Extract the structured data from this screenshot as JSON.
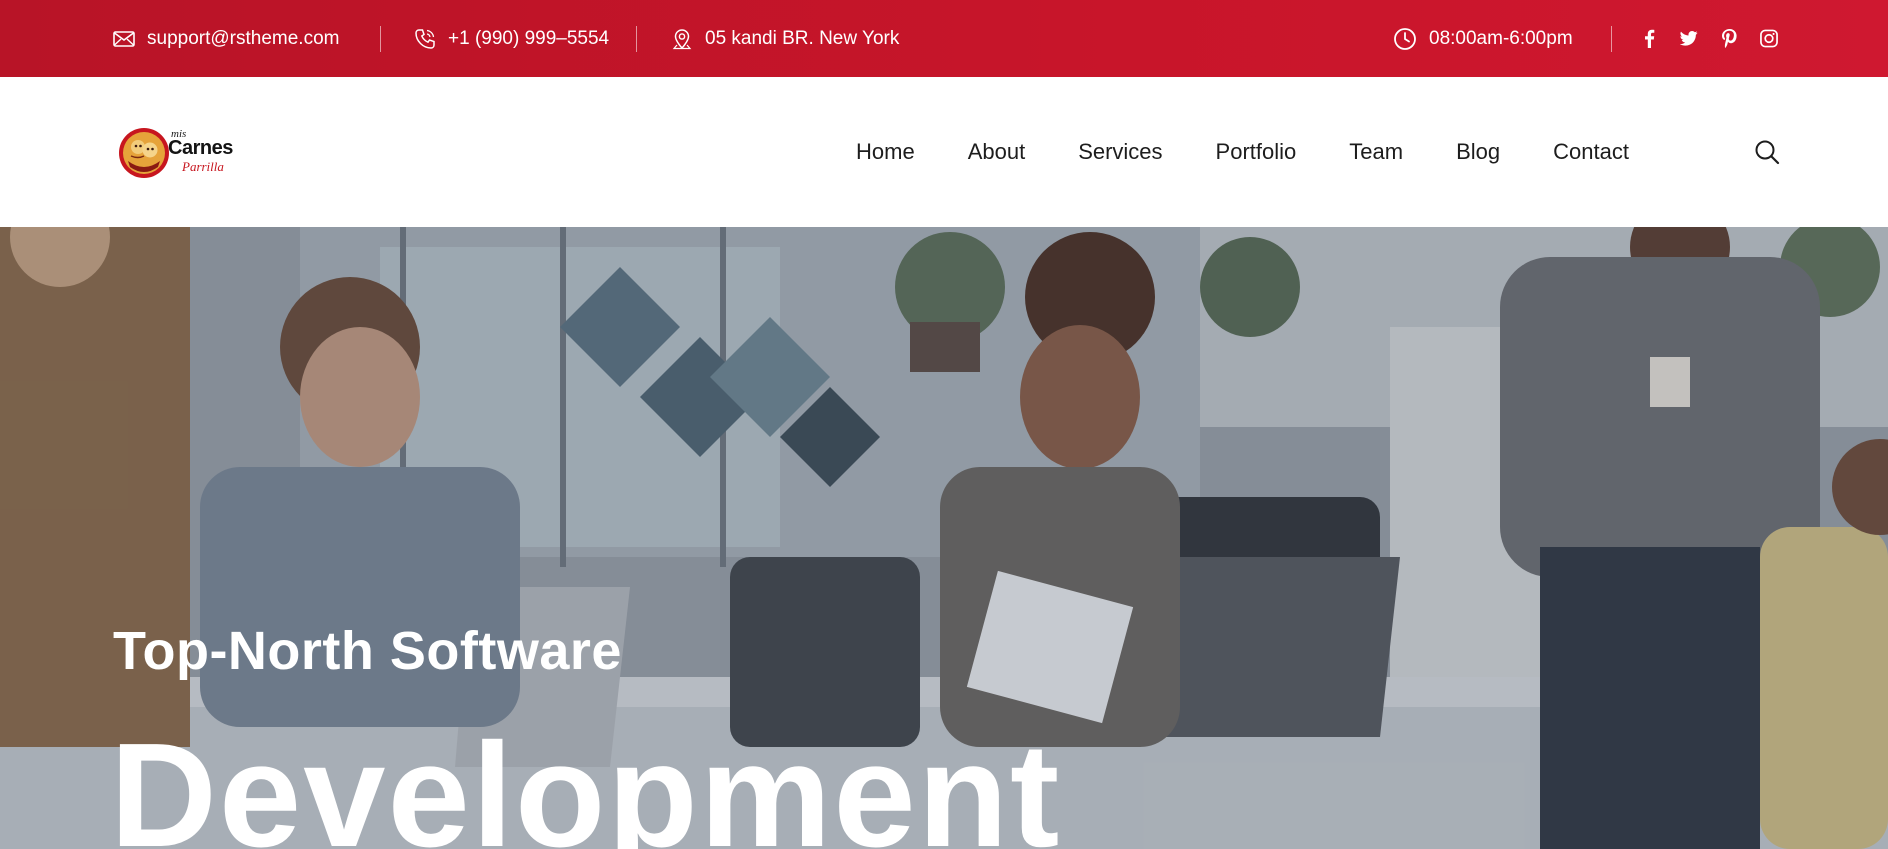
{
  "topbar": {
    "email": "support@rstheme.com",
    "phone": "+1 (990) 999–5554",
    "address": "05 kandi BR. New York",
    "hours": "08:00am-6:00pm",
    "social": [
      "facebook-icon",
      "twitter-icon",
      "pinterest-icon",
      "instagram-icon"
    ],
    "icons": {
      "email": "envelope-icon",
      "phone": "phone-icon",
      "address": "map-pin-icon",
      "hours": "clock-icon"
    }
  },
  "header": {
    "logo": {
      "line1": "mis",
      "line2": "Carnes",
      "line3": "Parrilla"
    },
    "nav": [
      "Home",
      "About",
      "Services",
      "Portfolio",
      "Team",
      "Blog",
      "Contact"
    ],
    "search_icon": "search-icon"
  },
  "hero": {
    "subtitle": "Top-North Software",
    "title": "Development"
  },
  "colors": {
    "topbar_bg": "#c1152a",
    "nav_text": "#1d1d1d",
    "hero_text": "#ffffff"
  }
}
